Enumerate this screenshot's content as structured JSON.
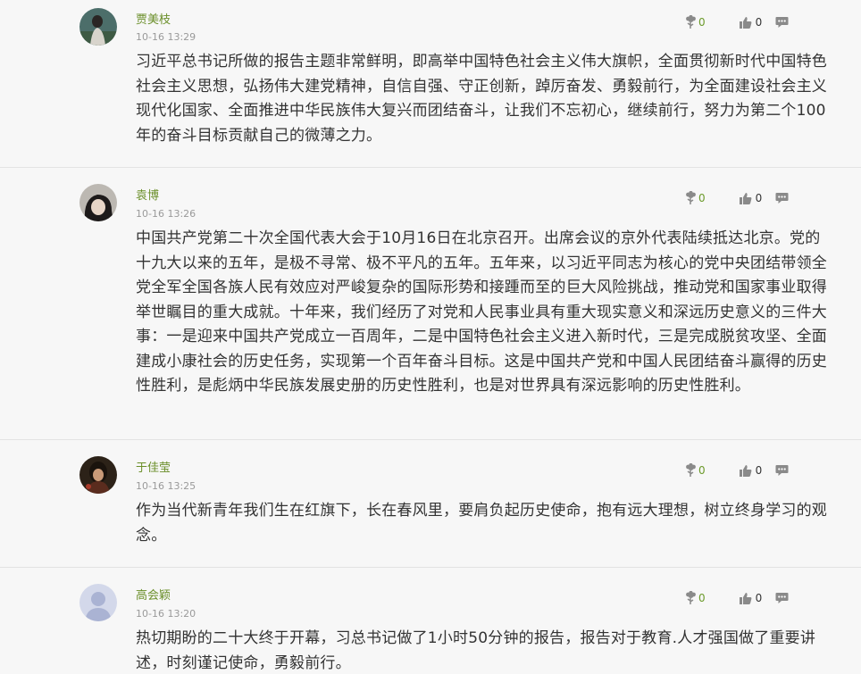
{
  "comments": [
    {
      "author": "贾美枝",
      "time": "10-16 13:29",
      "flowers": "0",
      "likes": "0",
      "text": "习近平总书记所做的报告主题非常鲜明，即高举中国特色社会主义伟大旗帜，全面贯彻新时代中国特色社会主义思想，弘扬伟大建党精神，自信自强、守正创新，踔厉奋发、勇毅前行，为全面建设社会主义现代化国家、全面推进中华民族伟大复兴而团结奋斗，让我们不忘初心，继续前行，努力为第二个100年的奋斗目标贡献自己的微薄之力。",
      "avatar_icon": "photo-avatar-outdoor"
    },
    {
      "author": "袁博",
      "time": "10-16 13:26",
      "flowers": "0",
      "likes": "0",
      "text": "中国共产党第二十次全国代表大会于10月16日在北京召开。出席会议的京外代表陆续抵达北京。党的十九大以来的五年，是极不寻常、极不平凡的五年。五年来，以习近平同志为核心的党中央团结带领全党全军全国各族人民有效应对严峻复杂的国际形势和接踵而至的巨大风险挑战，推动党和国家事业取得举世瞩目的重大成就。十年来，我们经历了对党和人民事业具有重大现实意义和深远历史意义的三件大事：一是迎来中国共产党成立一百周年，二是中国特色社会主义进入新时代，三是完成脱贫攻坚、全面建成小康社会的历史任务，实现第一个百年奋斗目标。这是中国共产党和中国人民团结奋斗赢得的历史性胜利，是彪炳中华民族发展史册的历史性胜利，也是对世界具有深远影响的历史性胜利。",
      "avatar_icon": "photo-avatar-portrait"
    },
    {
      "author": "于佳莹",
      "time": "10-16 13:25",
      "flowers": "0",
      "likes": "0",
      "text": "作为当代新青年我们生在红旗下，长在春风里，要肩负起历史使命，抱有远大理想，树立终身学习的观念。",
      "avatar_icon": "photo-avatar-dark"
    },
    {
      "author": "高会颖",
      "time": "10-16 13:20",
      "flowers": "0",
      "likes": "0",
      "text": "热切期盼的二十大终于开幕，习总书记做了1小时50分钟的报告，报告对于教育.人才强国做了重要讲述，时刻谨记使命，勇毅前行。",
      "avatar_icon": "default-user-avatar-icon"
    }
  ],
  "colors": {
    "author": "#6b8f2a",
    "flower_count": "#6b9a2a",
    "background": "#f7f7f7",
    "divider": "#e3e3e3"
  }
}
